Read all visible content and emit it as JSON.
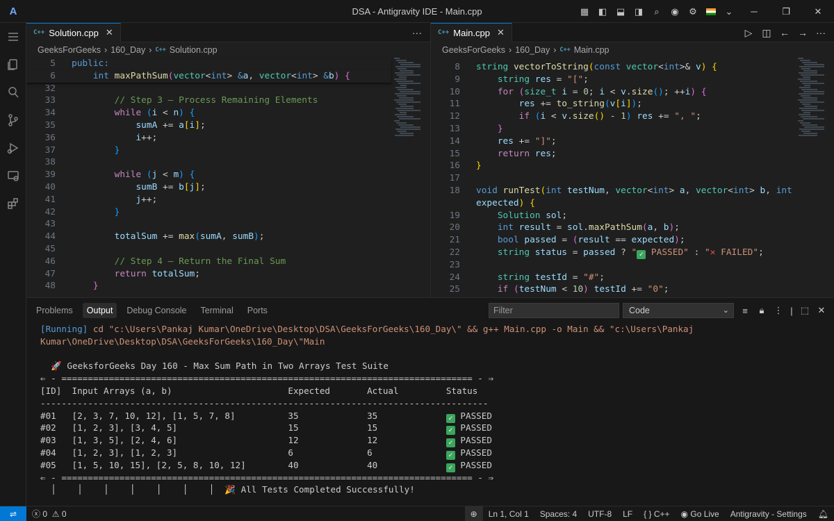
{
  "window": {
    "title": "DSA - Antigravity IDE - Main.cpp",
    "logo": "A"
  },
  "left_editor": {
    "tab": {
      "name": "Solution.cpp",
      "lang_badge": "C++"
    },
    "breadcrumb": [
      "GeeksForGeeks",
      "160_Day",
      "Solution.cpp"
    ],
    "sticky_lines": [
      {
        "n": "5",
        "html": "<span class=\"kw\">public:</span>"
      },
      {
        "n": "6",
        "html": "    <span class=\"kw\">int</span> <span class=\"fn\">maxPathSum</span><span class=\"br2\">(</span><span class=\"ty\">vector</span>&lt;<span class=\"kw\">int</span>&gt; <span class=\"kw\">&amp;</span><span class=\"var\">a</span>, <span class=\"ty\">vector</span>&lt;<span class=\"kw\">int</span>&gt; <span class=\"kw\">&amp;</span><span class=\"var\">b</span><span class=\"br2\">)</span> <span class=\"br2\">{</span>"
      }
    ],
    "lines": [
      {
        "n": "32",
        "html": "        "
      },
      {
        "n": "33",
        "html": "        <span class=\"cm\">// Step 3 — Process Remaining Elements</span>"
      },
      {
        "n": "34",
        "html": "        <span class=\"ctl\">while</span> <span class=\"br3\">(</span><span class=\"var\">i</span> &lt; <span class=\"var\">n</span><span class=\"br3\">)</span> <span class=\"br3\">{</span>"
      },
      {
        "n": "35",
        "html": "            <span class=\"var\">sumA</span> += <span class=\"var\">a</span><span class=\"br1\">[</span><span class=\"var\">i</span><span class=\"br1\">]</span>;"
      },
      {
        "n": "36",
        "html": "            <span class=\"var\">i</span>++;"
      },
      {
        "n": "37",
        "html": "        <span class=\"br3\">}</span>"
      },
      {
        "n": "38",
        "html": ""
      },
      {
        "n": "39",
        "html": "        <span class=\"ctl\">while</span> <span class=\"br3\">(</span><span class=\"var\">j</span> &lt; <span class=\"var\">m</span><span class=\"br3\">)</span> <span class=\"br3\">{</span>"
      },
      {
        "n": "40",
        "html": "            <span class=\"var\">sumB</span> += <span class=\"var\">b</span><span class=\"br1\">[</span><span class=\"var\">j</span><span class=\"br1\">]</span>;"
      },
      {
        "n": "41",
        "html": "            <span class=\"var\">j</span>++;"
      },
      {
        "n": "42",
        "html": "        <span class=\"br3\">}</span>"
      },
      {
        "n": "43",
        "html": ""
      },
      {
        "n": "44",
        "html": "        <span class=\"var\">totalSum</span> += <span class=\"fn\">max</span><span class=\"br3\">(</span><span class=\"var\">sumA</span>, <span class=\"var\">sumB</span><span class=\"br3\">)</span>;"
      },
      {
        "n": "45",
        "html": ""
      },
      {
        "n": "46",
        "html": "        <span class=\"cm\">// Step 4 — Return the Final Sum</span>"
      },
      {
        "n": "47",
        "html": "        <span class=\"ctl\">return</span> <span class=\"var\">totalSum</span>;"
      },
      {
        "n": "48",
        "html": "    <span class=\"br2\">}</span>"
      }
    ]
  },
  "right_editor": {
    "tab": {
      "name": "Main.cpp",
      "lang_badge": "C++"
    },
    "breadcrumb": [
      "GeeksForGeeks",
      "160_Day",
      "Main.cpp"
    ],
    "lines": [
      {
        "n": "8",
        "html": "<span class=\"ty\">string</span> <span class=\"fn\">vectorToString</span><span class=\"br1\">(</span><span class=\"kw\">const</span> <span class=\"ty\">vector</span>&lt;<span class=\"kw\">int</span>&gt;&amp; <span class=\"var\">v</span><span class=\"br1\">)</span> <span class=\"br1\">{</span>"
      },
      {
        "n": "9",
        "html": "    <span class=\"ty\">string</span> <span class=\"var\">res</span> = <span class=\"str\">\"[\"</span>;"
      },
      {
        "n": "10",
        "html": "    <span class=\"ctl\">for</span> <span class=\"br2\">(</span><span class=\"ty\">size_t</span> <span class=\"var\">i</span> = <span class=\"num\">0</span>; <span class=\"var\">i</span> &lt; <span class=\"var\">v</span>.<span class=\"fn\">size</span><span class=\"br3\">()</span>; ++<span class=\"var\">i</span><span class=\"br2\">)</span> <span class=\"br2\">{</span>"
      },
      {
        "n": "11",
        "html": "        <span class=\"var\">res</span> += <span class=\"fn\">to_string</span><span class=\"br3\">(</span><span class=\"var\">v</span><span class=\"br1\">[</span><span class=\"var\">i</span><span class=\"br1\">]</span><span class=\"br3\">)</span>;"
      },
      {
        "n": "12",
        "html": "        <span class=\"ctl\">if</span> <span class=\"br3\">(</span><span class=\"var\">i</span> &lt; <span class=\"var\">v</span>.<span class=\"fn\">size</span><span class=\"br1\">()</span> - <span class=\"num\">1</span><span class=\"br3\">)</span> <span class=\"var\">res</span> += <span class=\"str\">\", \"</span>;"
      },
      {
        "n": "13",
        "html": "    <span class=\"br2\">}</span>"
      },
      {
        "n": "14",
        "html": "    <span class=\"var\">res</span> += <span class=\"str\">\"]\"</span>;"
      },
      {
        "n": "15",
        "html": "    <span class=\"ctl\">return</span> <span class=\"var\">res</span>;"
      },
      {
        "n": "16",
        "html": "<span class=\"br1\">}</span>"
      },
      {
        "n": "17",
        "html": ""
      },
      {
        "n": "18",
        "html": "<span class=\"kw\">void</span> <span class=\"fn\">runTest</span><span class=\"br1\">(</span><span class=\"kw\">int</span> <span class=\"var\">testNum</span>, <span class=\"ty\">vector</span>&lt;<span class=\"kw\">int</span>&gt; <span class=\"var\">a</span>, <span class=\"ty\">vector</span>&lt;<span class=\"kw\">int</span>&gt; <span class=\"var\">b</span>, <span class=\"kw\">int</span>"
      },
      {
        "n": "",
        "html": "<span class=\"var\">expected</span><span class=\"br1\">)</span> <span class=\"br1\">{</span>"
      },
      {
        "n": "19",
        "html": "    <span class=\"ty\">Solution</span> <span class=\"var\">sol</span>;"
      },
      {
        "n": "20",
        "html": "    <span class=\"kw\">int</span> <span class=\"var\">result</span> = <span class=\"var\">sol</span>.<span class=\"fn\">maxPathSum</span><span class=\"br2\">(</span><span class=\"var\">a</span>, <span class=\"var\">b</span><span class=\"br2\">)</span>;"
      },
      {
        "n": "21",
        "html": "    <span class=\"kw\">bool</span> <span class=\"var\">passed</span> = <span class=\"br2\">(</span><span class=\"var\">result</span> == <span class=\"var\">expected</span><span class=\"br2\">)</span>;"
      },
      {
        "n": "22",
        "html": "    <span class=\"ty\">string</span> <span class=\"var\">status</span> = <span class=\"var\">passed</span> ? <span class=\"str\">\"<span class=\"chk\">✓</span> PASSED\"</span> : <span class=\"str\">\"<span class=\"xbox\">✕</span> FAILED\"</span>;"
      },
      {
        "n": "23",
        "html": ""
      },
      {
        "n": "24",
        "html": "    <span class=\"ty\">string</span> <span class=\"var\">testId</span> = <span class=\"str\">\"#\"</span>;"
      },
      {
        "n": "25",
        "html": "    <span class=\"ctl\">if</span> <span class=\"br2\">(</span><span class=\"var\">testNum</span> &lt; <span class=\"num\">10</span><span class=\"br2\">)</span> <span class=\"var\">testId</span> += <span class=\"str\">\"0\"</span>;"
      }
    ]
  },
  "panel": {
    "tabs": [
      "Problems",
      "Output",
      "Debug Console",
      "Terminal",
      "Ports"
    ],
    "active_tab": "Output",
    "filter_placeholder": "Filter",
    "channel": "Code",
    "output_lines": [
      {
        "html": "<span class=\"run\">[Running]</span> <span class=\"cmd\">cd \"c:\\Users\\Pankaj Kumar\\OneDrive\\Desktop\\DSA\\GeeksForGeeks\\160_Day\\\" &amp;&amp; g++ Main.cpp -o Main &amp;&amp; \"c:\\Users\\Pankaj</span>"
      },
      {
        "html": "<span class=\"cmd\">Kumar\\OneDrive\\Desktop\\DSA\\GeeksForGeeks\\160_Day\\\"Main</span>"
      },
      {
        "html": ""
      },
      {
        "html": "  🚀 GeeksforGeeks Day 160 - Max Sum Path in Two Arrays Test Suite"
      },
      {
        "html": "⇐ - ============================================================================== - ⇒"
      },
      {
        "html": "[ID]  Input Arrays (a, b)                      Expected       Actual         Status"
      },
      {
        "html": "-------------------------------------------------------------------------------------"
      },
      {
        "html": "#01   [2, 3, 7, 10, 12], [1, 5, 7, 8]          35             35             <span class=\"chk\">✓</span> PASSED"
      },
      {
        "html": "#02   [1, 2, 3], [3, 4, 5]                     15             15             <span class=\"chk\">✓</span> PASSED"
      },
      {
        "html": "#03   [1, 3, 5], [2, 4, 6]                     12             12             <span class=\"chk\">✓</span> PASSED"
      },
      {
        "html": "#04   [1, 2, 3], [1, 2, 3]                     6              6              <span class=\"chk\">✓</span> PASSED"
      },
      {
        "html": "#05   [1, 5, 10, 15], [2, 5, 8, 10, 12]        40             40             <span class=\"chk\">✓</span> PASSED"
      },
      {
        "html": "⇐ - ============================================================================== - ⇒"
      },
      {
        "html": "  │    │    │    │    │    │    │  🎉 All Tests Completed Successfully!"
      }
    ]
  },
  "statusbar": {
    "errors": "0",
    "warnings": "0",
    "position": "Ln 1, Col 1",
    "spaces": "Spaces: 4",
    "encoding": "UTF-8",
    "eol": "LF",
    "language": "C++",
    "go_live": "Go Live",
    "settings": "Antigravity - Settings"
  },
  "colors": {
    "accent": "#0078d4",
    "background": "#1e1e1e",
    "chrome": "#181818"
  }
}
